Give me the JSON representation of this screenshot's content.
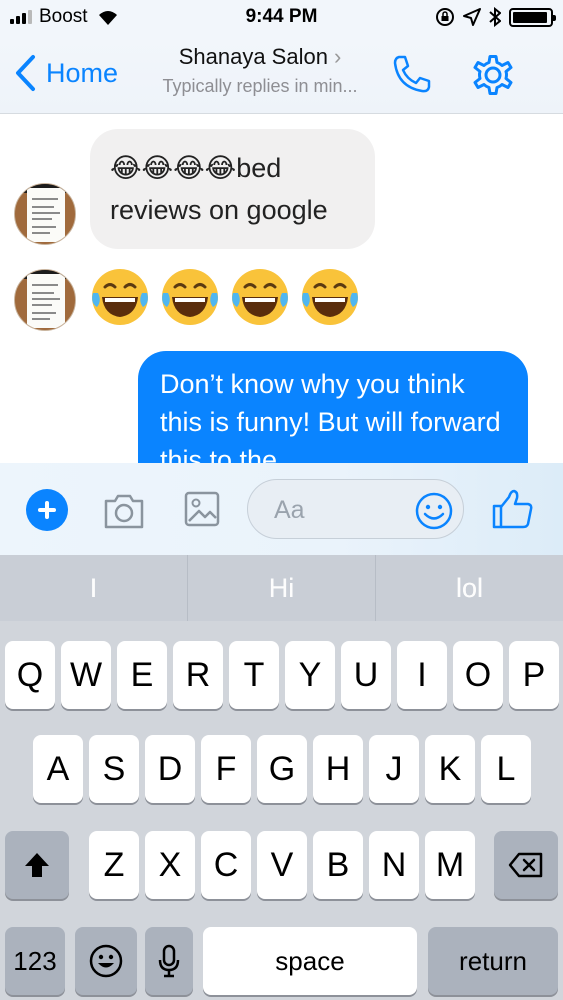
{
  "status_bar": {
    "carrier": "Boost",
    "time": "9:44 PM",
    "battery_level": 0.95
  },
  "header": {
    "back_label": "Home",
    "contact_name": "Shanaya Salon",
    "subtitle": "Typically replies in min..."
  },
  "messages": {
    "incoming_1": "😂😂😂😂bed reviews on google",
    "incoming_2_emojis": [
      "😂",
      "😂",
      "😂",
      "😂"
    ],
    "outgoing_1": "Don’t know why you think this is funny! But will forward this to the"
  },
  "composer": {
    "placeholder": "Aa"
  },
  "keyboard": {
    "predictions": [
      "I",
      "Hi",
      "lol"
    ],
    "row1": [
      "Q",
      "W",
      "E",
      "R",
      "T",
      "Y",
      "U",
      "I",
      "O",
      "P"
    ],
    "row2": [
      "A",
      "S",
      "D",
      "F",
      "G",
      "H",
      "J",
      "K",
      "L"
    ],
    "row3": [
      "Z",
      "X",
      "C",
      "V",
      "B",
      "N",
      "M"
    ],
    "numbers_label": "123",
    "space_label": "space",
    "return_label": "return"
  },
  "colors": {
    "accent": "#0a84ff",
    "incoming_bubble": "#f1f0f0",
    "keyboard_bg": "#d1d5db"
  },
  "icons": [
    "signal-icon",
    "wifi-icon",
    "lock-rotation-icon",
    "location-icon",
    "bluetooth-icon",
    "battery-icon",
    "back-chevron-icon",
    "phone-icon",
    "gear-icon",
    "plus-icon",
    "camera-icon",
    "image-icon",
    "smile-icon",
    "thumbs-up-icon",
    "shift-icon",
    "delete-icon",
    "emoji-icon",
    "microphone-icon"
  ]
}
